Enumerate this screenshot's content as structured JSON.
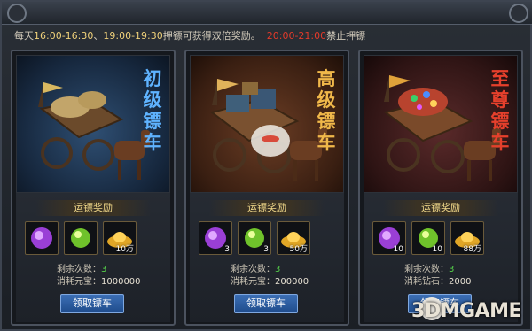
{
  "notice": {
    "prefix": "每天",
    "time1": "16:00-16:30",
    "sep": "、",
    "time2": "19:00-19:30",
    "middle": "押镖可获得双倍奖励。",
    "time3": "20:00-21:00",
    "suffix": "禁止押镖"
  },
  "cards": [
    {
      "title": "初级镖车",
      "title_color": "#5fb3ff",
      "reward_title": "运镖奖励",
      "items": [
        {
          "icon": "purple-crystal-icon",
          "qty": ""
        },
        {
          "icon": "green-orb-icon",
          "qty": ""
        },
        {
          "icon": "gold-ingot-icon",
          "qty": "10万"
        }
      ],
      "stats": [
        {
          "label": "剩余次数：",
          "value": "3"
        },
        {
          "label": "消耗元宝：",
          "value": "1000000"
        }
      ],
      "button": "领取镖车"
    },
    {
      "title": "高级镖车",
      "title_color": "#f0b84a",
      "reward_title": "运镖奖励",
      "items": [
        {
          "icon": "purple-crystal-icon",
          "qty": "3"
        },
        {
          "icon": "green-orb-icon",
          "qty": "3"
        },
        {
          "icon": "gold-ingot-icon",
          "qty": "50万"
        }
      ],
      "stats": [
        {
          "label": "剩余次数：",
          "value": "3"
        },
        {
          "label": "消耗元宝：",
          "value": "200000"
        }
      ],
      "button": "领取镖车"
    },
    {
      "title": "至尊镖车",
      "title_color": "#e6402c",
      "reward_title": "运镖奖励",
      "items": [
        {
          "icon": "purple-crystal-icon",
          "qty": "10"
        },
        {
          "icon": "green-orb-icon",
          "qty": "10"
        },
        {
          "icon": "gold-ingot-icon",
          "qty": "88万"
        }
      ],
      "stats": [
        {
          "label": "剩余次数：",
          "value": "3"
        },
        {
          "label": "消耗钻石：",
          "value": "2000"
        }
      ],
      "button": "领取镖车"
    }
  ],
  "watermark": "3DMGAME"
}
